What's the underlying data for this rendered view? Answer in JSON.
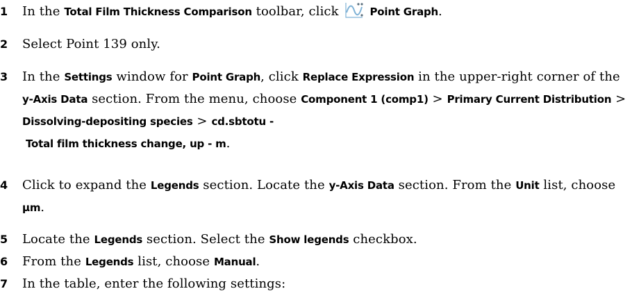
{
  "steps": [
    {
      "number": "1",
      "parts": [
        {
          "t": "In the ",
          "ui": false
        },
        {
          "t": "Total Film Thickness Comparison",
          "ui": true
        },
        {
          "t": " toolbar, click ",
          "ui": false
        },
        {
          "icon": "point-graph-icon"
        },
        {
          "t": " Point Graph",
          "ui": true
        },
        {
          "t": ".",
          "ui": false
        }
      ]
    },
    {
      "number": "2",
      "parts": [
        {
          "t": "Select Point 139 only.",
          "ui": false
        }
      ]
    },
    {
      "number": "3",
      "parts": [
        {
          "t": "In the ",
          "ui": false
        },
        {
          "t": "Settings",
          "ui": true
        },
        {
          "t": " window for ",
          "ui": false
        },
        {
          "t": "Point Graph",
          "ui": true
        },
        {
          "t": ", click ",
          "ui": false
        },
        {
          "t": "Replace Expression",
          "ui": true
        },
        {
          "t": " in the upper-right corner of the ",
          "ui": false
        },
        {
          "t": "y-Axis Data",
          "ui": true
        },
        {
          "t": " section. From the menu, choose ",
          "ui": false
        },
        {
          "t": "Component 1 (comp1)",
          "ui": true
        },
        {
          "t": " > ",
          "ui": false
        },
        {
          "t": "Primary Current Distribution",
          "ui": true
        },
        {
          "t": " > ",
          "ui": false
        },
        {
          "t": "Dissolving-depositing species",
          "ui": true
        },
        {
          "t": " > ",
          "ui": false
        },
        {
          "t": "cd.sbtotu - ",
          "ui": true
        },
        {
          "br": true
        },
        {
          "t": " Total film thickness change, up - m",
          "ui": true
        },
        {
          "t": ".",
          "ui": false
        }
      ]
    },
    {
      "number": "4",
      "parts": [
        {
          "t": "Click to expand the ",
          "ui": false
        },
        {
          "t": "Legends",
          "ui": true
        },
        {
          "t": " section. Locate the ",
          "ui": false
        },
        {
          "t": "y-Axis Data",
          "ui": true
        },
        {
          "t": " section. From the ",
          "ui": false
        },
        {
          "t": "Unit",
          "ui": true
        },
        {
          "t": " list, choose ",
          "ui": false
        },
        {
          "t": "µm",
          "ui": true
        },
        {
          "t": ".",
          "ui": false
        }
      ]
    },
    {
      "number": "5",
      "parts": [
        {
          "t": "Locate the ",
          "ui": false
        },
        {
          "t": "Legends",
          "ui": true
        },
        {
          "t": " section. Select the ",
          "ui": false
        },
        {
          "t": "Show legends",
          "ui": true
        },
        {
          "t": " checkbox.",
          "ui": false
        }
      ]
    },
    {
      "number": "6",
      "parts": [
        {
          "t": "From the ",
          "ui": false
        },
        {
          "t": "Legends",
          "ui": true
        },
        {
          "t": " list, choose ",
          "ui": false
        },
        {
          "t": "Manual",
          "ui": true
        },
        {
          "t": ".",
          "ui": false
        }
      ]
    },
    {
      "number": "7",
      "parts": [
        {
          "t": "In the table, enter the following settings:",
          "ui": false
        }
      ]
    }
  ],
  "colors": {
    "text": "#000000",
    "icon_stroke": "#7fb2d6",
    "icon_dot": "#5a6e7d"
  }
}
